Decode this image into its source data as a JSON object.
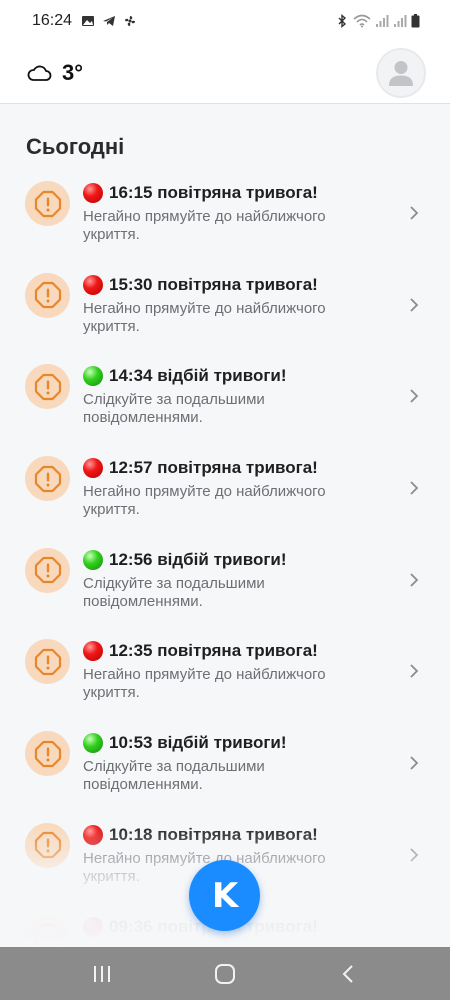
{
  "status_bar": {
    "time": "16:24",
    "left_icons": [
      "image-icon",
      "telegram-icon",
      "fan-icon"
    ],
    "right_icons": [
      "bluetooth-icon",
      "wifi-icon",
      "signal-icon",
      "signal-icon",
      "battery-icon"
    ]
  },
  "header": {
    "weather_icon": "cloud-icon",
    "temperature": "3°",
    "avatar_icon": "user-icon"
  },
  "section": {
    "title": "Сьогодні"
  },
  "alerts": [
    {
      "status": "red",
      "title": "16:15 повітряна тривога!",
      "description": "Негайно прямуйте до найближчого укриття."
    },
    {
      "status": "red",
      "title": "15:30 повітряна тривога!",
      "description": "Негайно прямуйте до найближчого укриття."
    },
    {
      "status": "green",
      "title": "14:34 відбій тривоги!",
      "description": "Слідкуйте за подальшими повідомленнями."
    },
    {
      "status": "red",
      "title": "12:57 повітряна тривога!",
      "description": "Негайно прямуйте до найближчого укриття."
    },
    {
      "status": "green",
      "title": "12:56 відбій тривоги!",
      "description": "Слідкуйте за подальшими повідомленнями."
    },
    {
      "status": "red",
      "title": "12:35 повітряна тривога!",
      "description": "Негайно прямуйте до найближчого укриття."
    },
    {
      "status": "green",
      "title": "10:53 відбій тривоги!",
      "description": "Слідкуйте за подальшими повідомленнями."
    },
    {
      "status": "red",
      "title": "10:18 повітряна тривога!",
      "description": "Негайно прямуйте до найближчого укриття."
    },
    {
      "status": "red",
      "title": "09:36 повітряна тривога!",
      "description": ""
    }
  ],
  "fab": {
    "letter": "K",
    "color": "#1a8cff"
  },
  "nav_bar": {
    "icons": [
      "recent-apps-icon",
      "home-icon",
      "back-icon"
    ]
  },
  "colors": {
    "alert_badge_bg": "#f8d9bd",
    "alert_badge_icon": "#e8862a",
    "red_dot": "#e81414",
    "green_dot": "#2ec41d"
  }
}
